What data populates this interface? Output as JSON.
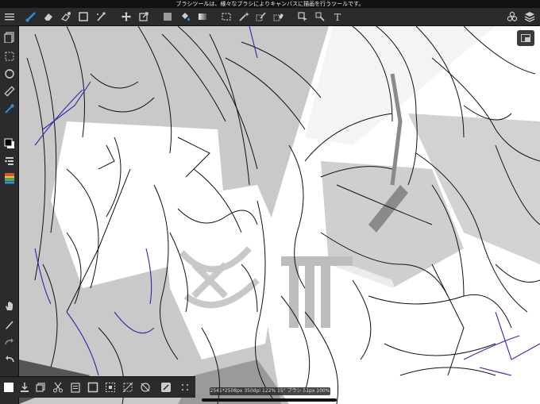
{
  "status_bar": {
    "hint": "ブラシツールは、様々なブラシによりキャンバスに描画を行うツールです。"
  },
  "top_toolbar": {
    "items": [
      {
        "name": "menu-icon",
        "label": "menu"
      },
      {
        "name": "brush-icon",
        "label": "brush"
      },
      {
        "name": "eraser-icon",
        "label": "eraser"
      },
      {
        "name": "smudge-icon",
        "label": "smudge"
      },
      {
        "name": "shape-icon",
        "label": "shape"
      },
      {
        "name": "filter-icon",
        "label": "filter"
      },
      {
        "name": "move-icon",
        "label": "move"
      },
      {
        "name": "transform-icon",
        "label": "transform"
      },
      {
        "name": "fill-icon",
        "label": "fill"
      },
      {
        "name": "bucket-icon",
        "label": "bucket"
      },
      {
        "name": "gradient-icon",
        "label": "gradient"
      },
      {
        "name": "select-icon",
        "label": "select"
      },
      {
        "name": "magic-wand-icon",
        "label": "magic wand"
      },
      {
        "name": "select-pen-icon",
        "label": "select pen"
      },
      {
        "name": "select-eraser-icon",
        "label": "select eraser"
      },
      {
        "name": "text-icon",
        "label": "T"
      },
      {
        "name": "materials-icon",
        "label": "materials"
      },
      {
        "name": "layers-icon",
        "label": "layers"
      }
    ]
  },
  "left_toolbar": {
    "items": [
      "layers-panel-icon",
      "selection-icon",
      "rotate-icon",
      "ruler-icon",
      "eyedropper-icon",
      "color-swatch-icon",
      "brush-size-icon",
      "palette-icon",
      "hand-icon",
      "pen-mode-icon",
      "redo-icon",
      "undo-icon"
    ]
  },
  "bottom_toolbar": {
    "items": [
      "color-square-icon",
      "import-icon",
      "copy-layer-icon",
      "cut-icon",
      "paste-icon",
      "canvas-icon",
      "select-all-icon",
      "deselect-icon",
      "snap-icon",
      "more-icon"
    ]
  },
  "info_bar": {
    "text": "2541*2508px 350dpi 122% 15° ブラシ 51px 100%"
  },
  "colors": {
    "accent": "#2f8fdc",
    "toolbar_bg": "#2b2b2e",
    "canvas_gray": "#c8c8c8",
    "line_blue": "#2a2aa8"
  }
}
